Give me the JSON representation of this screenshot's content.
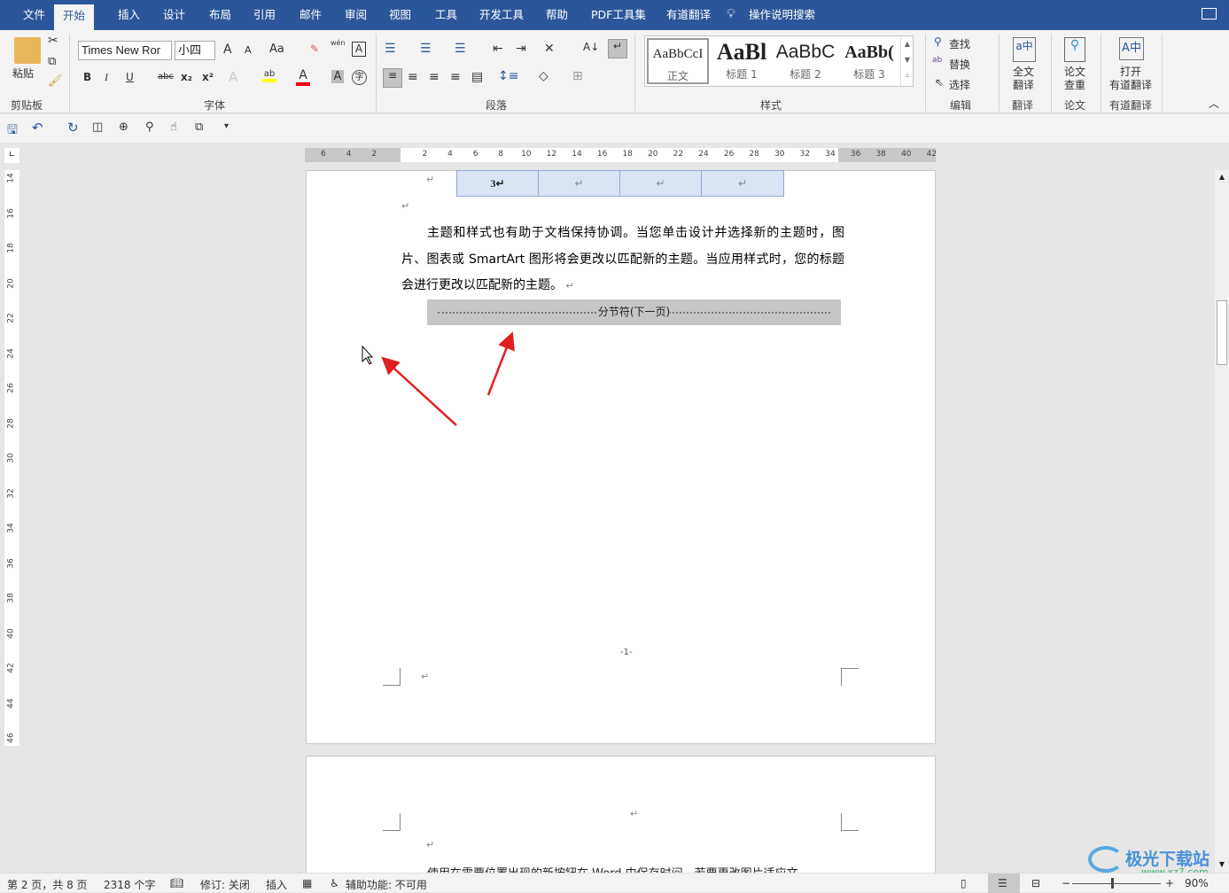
{
  "tabs": [
    {
      "label": "文件"
    },
    {
      "label": "开始",
      "active": true
    },
    {
      "label": "插入"
    },
    {
      "label": "设计"
    },
    {
      "label": "布局"
    },
    {
      "label": "引用"
    },
    {
      "label": "邮件"
    },
    {
      "label": "审阅"
    },
    {
      "label": "视图"
    },
    {
      "label": "工具"
    },
    {
      "label": "开发工具"
    },
    {
      "label": "帮助"
    },
    {
      "label": "PDF工具集"
    },
    {
      "label": "有道翻译"
    }
  ],
  "tell_me": "操作说明搜索",
  "ribbon": {
    "clipboard": {
      "paste": "粘贴",
      "label": "剪贴板"
    },
    "font": {
      "name": "Times New Ror",
      "size": "小四",
      "label": "字体",
      "bold": "B",
      "italic": "I",
      "underline": "U",
      "strike": "abc",
      "sub": "x₂",
      "sup": "x²",
      "grow": "A",
      "shrink": "A",
      "case": "Aa",
      "phonetic": "wén",
      "highlight_color": "#ffff00",
      "font_color": "#ff0000"
    },
    "paragraph": {
      "label": "段落"
    },
    "styles": {
      "label": "样式",
      "items": [
        {
          "preview": "AaBbCcI",
          "name": "正文"
        },
        {
          "preview": "AaBl",
          "name": "标题 1"
        },
        {
          "preview": "AaBbC",
          "name": "标题 2"
        },
        {
          "preview": "AaBb(",
          "name": "标题 3"
        }
      ]
    },
    "editing": {
      "find": "查找",
      "replace": "替换",
      "select": "选择",
      "label": "编辑"
    },
    "translate": {
      "btn1": "全文",
      "btn2": "翻译",
      "label": "翻译"
    },
    "paper": {
      "btn1": "论文",
      "btn2": "查重",
      "label": "论文"
    },
    "youdao": {
      "btn1": "打开",
      "btn2": "有道翻译",
      "label": "有道翻译"
    }
  },
  "ruler": {
    "h_labels": [
      "6",
      "4",
      "2",
      "",
      "2",
      "4",
      "6",
      "8",
      "10",
      "12",
      "14",
      "16",
      "18",
      "20",
      "22",
      "24",
      "26",
      "28",
      "30",
      "32",
      "34",
      "36",
      "38",
      "40",
      "42"
    ],
    "v_labels": [
      "14",
      "16",
      "18",
      "20",
      "22",
      "24",
      "26",
      "28",
      "30",
      "32",
      "34",
      "36",
      "38",
      "40",
      "42",
      "44",
      "46"
    ]
  },
  "document": {
    "table_cells": [
      "3↵",
      "↵",
      "↵",
      "↵"
    ],
    "paragraph": "主题和样式也有助于文档保持协调。当您单击设计并选择新的主题时，图片、图表或 SmartArt 图形将会更改以匹配新的主题。当应用样式时，您的标题会进行更改以匹配新的主题。",
    "section_break": "分节符(下一页)",
    "page_number": "-1-",
    "page2_text": "使用在需要位置出现的新按钮在 Word 中保存时间。若要更改图片适应文"
  },
  "status": {
    "page": "第 2 页，共 8 页",
    "words": "2318 个字",
    "track": "修订: 关闭",
    "mode": "插入",
    "accessibility": "辅助功能: 不可用",
    "zoom": "90%",
    "zoom_value": 90
  },
  "watermark": "极光下载站",
  "watermark_url": "www.xz7.com",
  "colors": {
    "brand": "#2b579a",
    "arrow": "#e02020",
    "table_fill": "#dbe4f3"
  }
}
